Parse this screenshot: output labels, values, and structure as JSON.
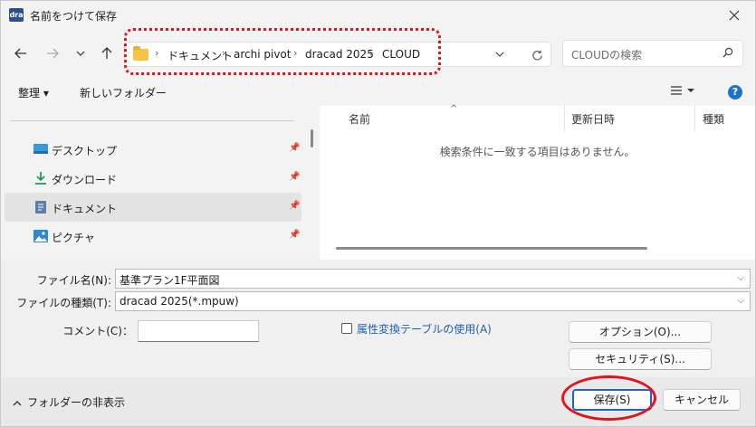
{
  "window": {
    "title": "名前をつけて保存",
    "app_icon_text": "dra"
  },
  "nav": {
    "breadcrumbs": [
      "ドキュメント",
      "archi pivot",
      "dracad 2025",
      "CLOUD"
    ],
    "search_placeholder": "CLOUDの検索"
  },
  "toolbar": {
    "organize": "整理 ▾",
    "new_folder": "新しいフォルダー"
  },
  "sidebar": {
    "items": [
      {
        "label": "デスクトップ",
        "icon": "desktop-icon"
      },
      {
        "label": "ダウンロード",
        "icon": "download-icon"
      },
      {
        "label": "ドキュメント",
        "icon": "documents-icon"
      },
      {
        "label": "ピクチャ",
        "icon": "pictures-icon"
      }
    ]
  },
  "files": {
    "columns": [
      "名前",
      "更新日時",
      "種類"
    ],
    "empty_message": "検索条件に一致する項目はありません。"
  },
  "form": {
    "filename_label": "ファイル名(N):",
    "filename_value": "基準プラン1F平面図",
    "filetype_label": "ファイルの種類(T):",
    "filetype_value": "dracad 2025(*.mpuw)",
    "comment_label": "コメント(C)：",
    "attr_checkbox_label": "属性変換テーブルの使用(A)",
    "options_button": "オプション(O)...",
    "security_button": "セキュリティ(S)..."
  },
  "footer": {
    "hide_folders": "フォルダーの非表示",
    "save_button": "保存(S)",
    "cancel_button": "キャンセル"
  },
  "colors": {
    "annotation": "#e0141e",
    "accent": "#1f65c4"
  }
}
